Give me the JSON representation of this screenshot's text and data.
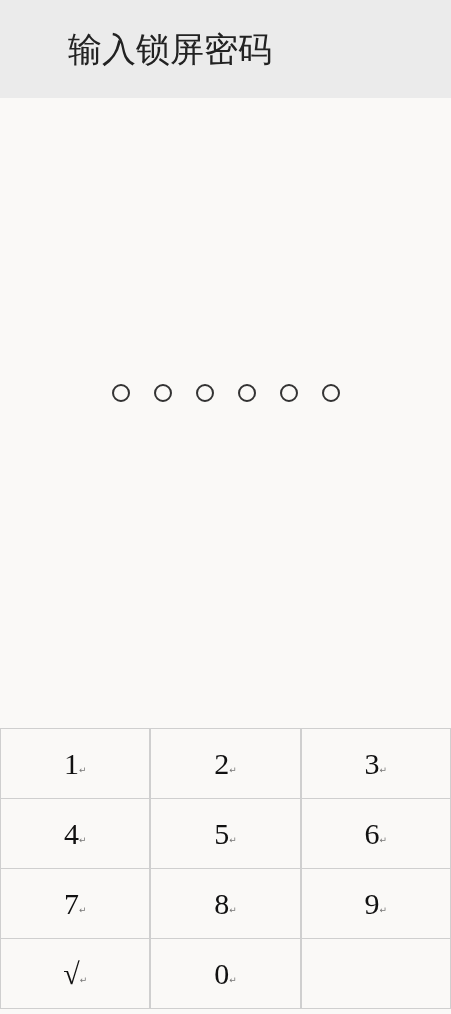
{
  "header": {
    "title": "输入锁屏密码"
  },
  "dots": [
    {
      "filled": false
    },
    {
      "filled": false
    },
    {
      "filled": false
    },
    {
      "filled": false
    },
    {
      "filled": false
    },
    {
      "filled": false
    }
  ],
  "keys": [
    {
      "label": "1",
      "mark": "↵"
    },
    {
      "label": "2",
      "mark": "↵"
    },
    {
      "label": "3",
      "mark": "↵"
    },
    {
      "label": "4",
      "mark": "↵"
    },
    {
      "label": "5",
      "mark": "↵"
    },
    {
      "label": "6",
      "mark": "↵"
    },
    {
      "label": "7",
      "mark": "↵"
    },
    {
      "label": "8",
      "mark": "↵"
    },
    {
      "label": "9",
      "mark": "↵"
    },
    {
      "label": "√",
      "mark": "↵"
    },
    {
      "label": "0",
      "mark": "↵"
    }
  ]
}
